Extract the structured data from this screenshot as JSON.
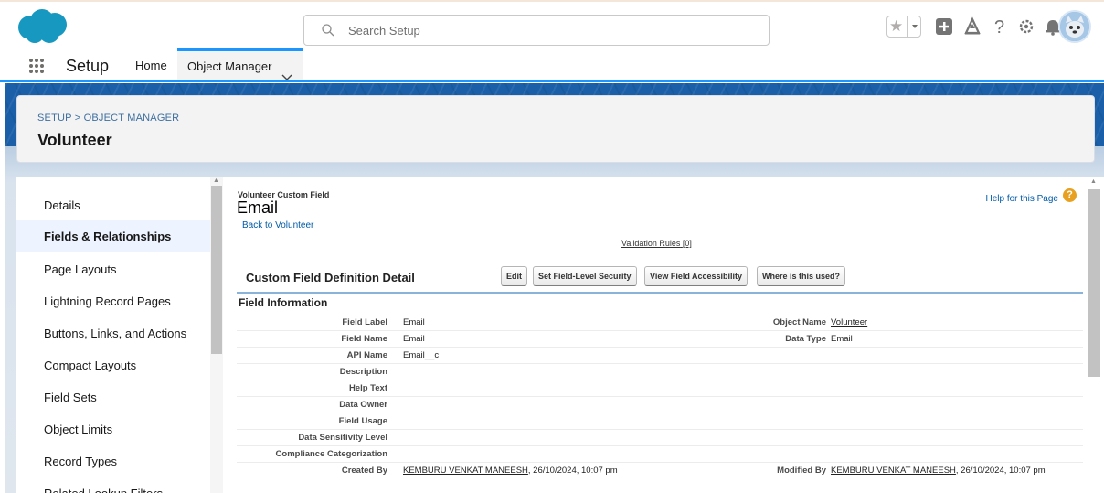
{
  "header": {
    "search_placeholder": "Search Setup",
    "icons": [
      "salesforce-cloud-logo",
      "search-icon",
      "favorites-star-icon",
      "add-icon",
      "trailhead-icon",
      "help-icon",
      "settings-gear-icon",
      "notification-bell-icon",
      "user-avatar"
    ]
  },
  "context_bar": {
    "app_name": "Setup",
    "tabs": [
      {
        "label": "Home"
      },
      {
        "label": "Object Manager"
      }
    ]
  },
  "page_header": {
    "breadcrumb": "SETUP > OBJECT MANAGER",
    "title": "Volunteer"
  },
  "sidebar": {
    "items": [
      {
        "label": "Details"
      },
      {
        "label": "Fields & Relationships",
        "active": true
      },
      {
        "label": "Page Layouts"
      },
      {
        "label": "Lightning Record Pages"
      },
      {
        "label": "Buttons, Links, and Actions"
      },
      {
        "label": "Compact Layouts"
      },
      {
        "label": "Field Sets"
      },
      {
        "label": "Object Limits"
      },
      {
        "label": "Record Types"
      },
      {
        "label": "Related Lookup Filters"
      }
    ]
  },
  "detail": {
    "object_type": "Volunteer Custom Field",
    "field_title": "Email",
    "back_link": "Back to Volunteer",
    "help_link": "Help for this Page",
    "validation_rules": "Validation Rules",
    "validation_count": "[0]",
    "section_title": "Custom Field Definition Detail",
    "buttons": {
      "edit": "Edit",
      "fls": "Set Field-Level Security",
      "vfa": "View Field Accessibility",
      "wiu": "Where is this used?"
    },
    "field_info_title": "Field Information",
    "rows": [
      {
        "label": "Field Label",
        "value": "Email",
        "label2": "Object Name",
        "value2": "Volunteer"
      },
      {
        "label": "Field Name",
        "value": "Email",
        "label2": "Data Type",
        "value2": "Email"
      },
      {
        "label": "API Name",
        "value": "Email__c"
      },
      {
        "label": "Description",
        "value": ""
      },
      {
        "label": "Help Text",
        "value": ""
      },
      {
        "label": "Data Owner",
        "value": ""
      },
      {
        "label": "Field Usage",
        "value": ""
      },
      {
        "label": "Data Sensitivity Level",
        "value": ""
      },
      {
        "label": "Compliance Categorization",
        "value": ""
      },
      {
        "label": "Created By",
        "value_user": "KEMBURU VENKAT MANEESH",
        "value_date": ", 26/10/2024, 10:07 pm",
        "label2": "Modified By",
        "value2_user": "KEMBURU VENKAT MANEESH",
        "value2_date": ", 26/10/2024, 10:07 pm"
      }
    ]
  },
  "colors": {
    "brand_blue": "#1b96ff",
    "link": "#015ba7",
    "band": "#1a5fa8",
    "help_orange": "#e8a020"
  }
}
